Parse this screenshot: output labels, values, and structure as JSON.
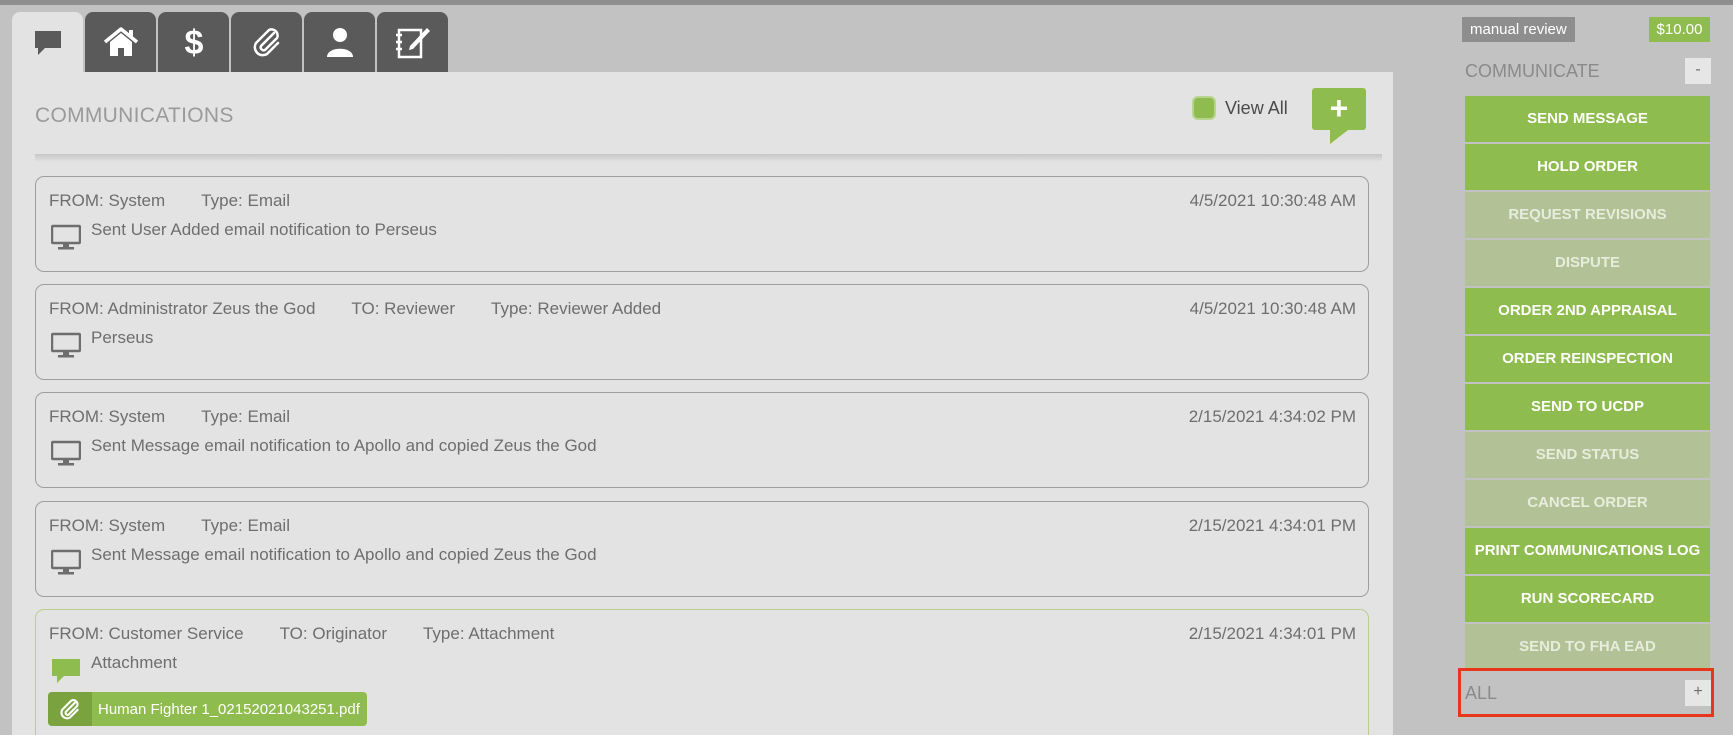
{
  "tabs": [
    {
      "icon": "speech-bubble-icon",
      "active": true
    },
    {
      "icon": "home-icon",
      "active": false
    },
    {
      "icon": "dollar-icon",
      "active": false
    },
    {
      "icon": "paperclip-icon",
      "active": false
    },
    {
      "icon": "person-icon",
      "active": false
    },
    {
      "icon": "notepad-pen-icon",
      "active": false
    }
  ],
  "main": {
    "title": "COMMUNICATIONS",
    "view_all_label": "View All",
    "add_icon": "+"
  },
  "messages": [
    {
      "from": "FROM: System",
      "to": "",
      "type": "Type: Email",
      "date": "4/5/2021 10:30:48 AM",
      "body": "Sent User Added email notification to Perseus",
      "icon": "monitor-icon"
    },
    {
      "from": "FROM: Administrator Zeus the God",
      "to": "TO: Reviewer",
      "type": "Type: Reviewer Added",
      "date": "4/5/2021 10:30:48 AM",
      "body": "Perseus",
      "icon": "monitor-icon"
    },
    {
      "from": "FROM: System",
      "to": "",
      "type": "Type: Email",
      "date": "2/15/2021 4:34:02 PM",
      "body": "Sent Message email notification to Apollo and copied Zeus the God",
      "icon": "monitor-icon"
    },
    {
      "from": "FROM: System",
      "to": "",
      "type": "Type: Email",
      "date": "2/15/2021 4:34:01 PM",
      "body": "Sent Message email notification to Apollo and copied Zeus the God",
      "icon": "monitor-icon"
    },
    {
      "from": "FROM: Customer Service",
      "to": "TO: Originator",
      "type": "Type: Attachment",
      "date": "2/15/2021 4:34:01 PM",
      "body": "Attachment",
      "icon": "speech-bubble-icon",
      "attachment": "Human Fighter 1_02152021043251.pdf"
    }
  ],
  "sidebar": {
    "badge_status": "manual review",
    "badge_price": "$10.00",
    "communicate_label": "COMMUNICATE",
    "communicate_toggle": "-",
    "actions": [
      {
        "label": "SEND MESSAGE",
        "enabled": true
      },
      {
        "label": "HOLD ORDER",
        "enabled": true
      },
      {
        "label": "REQUEST REVISIONS",
        "enabled": false
      },
      {
        "label": "DISPUTE",
        "enabled": false
      },
      {
        "label": "ORDER 2ND APPRAISAL",
        "enabled": true
      },
      {
        "label": "ORDER REINSPECTION",
        "enabled": true
      },
      {
        "label": "SEND TO UCDP",
        "enabled": true
      },
      {
        "label": "SEND STATUS",
        "enabled": false
      },
      {
        "label": "CANCEL ORDER",
        "enabled": false
      },
      {
        "label": "PRINT COMMUNICATIONS LOG",
        "enabled": true
      },
      {
        "label": "RUN SCORECARD",
        "enabled": true
      },
      {
        "label": "SEND TO FHA EAD",
        "enabled": false
      }
    ],
    "all_label": "ALL",
    "all_toggle": "+"
  },
  "colors": {
    "accent_green": "#8fbc4e",
    "disabled_green": "#b2c296",
    "highlight_red": "#e8361d"
  }
}
